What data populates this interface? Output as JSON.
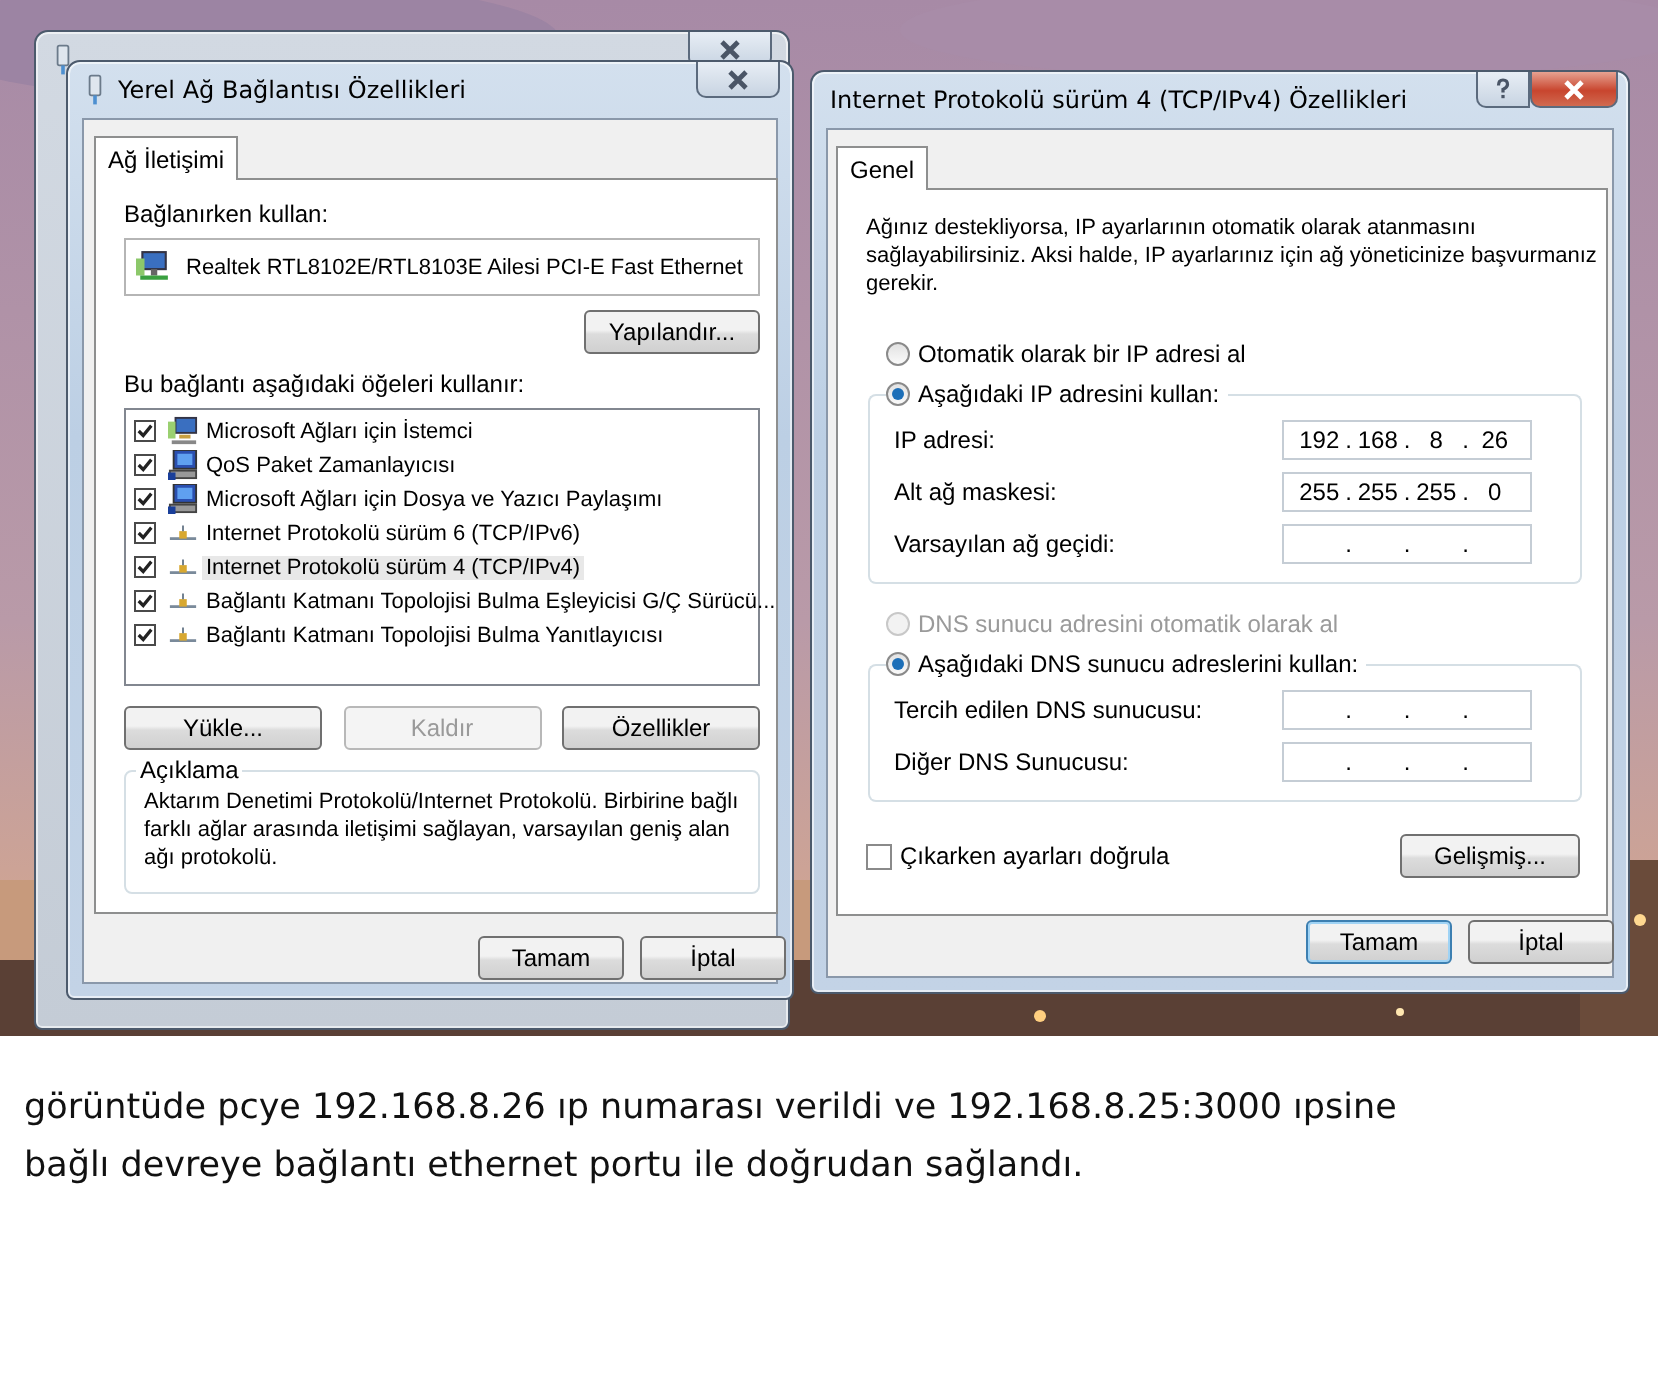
{
  "lan_properties": {
    "title": "Yerel Ağ Bağlantısı Özellikleri",
    "tabs": [
      {
        "label": "Ağ İletişimi",
        "selected": true
      }
    ],
    "connect_using_label": "Bağlanırken kullan:",
    "adapter": "Realtek RTL8102E/RTL8103E Ailesi PCI-E Fast Ethernet",
    "configure_button": "Yapılandır...",
    "items_label": "Bu bağlantı aşağıdaki öğeleri kullanır:",
    "items": [
      {
        "label": "Microsoft Ağları için İstemci",
        "kind": "client",
        "checked": true,
        "selected": false
      },
      {
        "label": "QoS Paket Zamanlayıcısı",
        "kind": "service",
        "checked": true,
        "selected": false
      },
      {
        "label": "Microsoft Ağları için Dosya ve Yazıcı Paylaşımı",
        "kind": "service",
        "checked": true,
        "selected": false
      },
      {
        "label": "Internet Protokolü sürüm 6 (TCP/IPv6)",
        "kind": "protocol",
        "checked": true,
        "selected": false
      },
      {
        "label": "Internet Protokolü sürüm 4 (TCP/IPv4)",
        "kind": "protocol",
        "checked": true,
        "selected": true
      },
      {
        "label": "Bağlantı Katmanı Topolojisi Bulma Eşleyicisi G/Ç Sürücü...",
        "kind": "protocol",
        "checked": true,
        "selected": false
      },
      {
        "label": "Bağlantı Katmanı Topolojisi Bulma Yanıtlayıcısı",
        "kind": "protocol",
        "checked": true,
        "selected": false
      }
    ],
    "item_buttons": [
      {
        "label": "Yükle...",
        "disabled": false
      },
      {
        "label": "Kaldır",
        "disabled": true
      },
      {
        "label": "Özellikler",
        "disabled": false
      }
    ],
    "description": {
      "title": "Açıklama",
      "text": "Aktarım Denetimi Protokolü/Internet Protokolü. Birbirine bağlı farklı ağlar arasında iletişimi sağlayan, varsayılan geniş alan ağı protokolü."
    },
    "footer_buttons": [
      {
        "label": "Tamam",
        "default": false
      },
      {
        "label": "İptal",
        "default": false
      }
    ]
  },
  "ipv4_properties": {
    "title": "Internet Protokolü sürüm 4 (TCP/IPv4) Özellikleri",
    "tabs": [
      {
        "label": "Genel",
        "selected": true
      }
    ],
    "intro": "Ağınız destekliyorsa, IP ayarlarının otomatik olarak atanmasını sağlayabilirsiniz. Aksi halde, IP ayarlarınız için ağ yöneticinize başvurmanız gerekir.",
    "separator": ".",
    "ip_modes": [
      {
        "label": "Otomatik olarak bir IP adresi al",
        "selected": false,
        "disabled": false
      },
      {
        "label": "Aşağıdaki IP adresini kullan:",
        "selected": true,
        "disabled": false
      }
    ],
    "ip_fields": [
      {
        "label": "IP adresi:",
        "octets": [
          "192",
          "168",
          "8",
          "26"
        ]
      },
      {
        "label": "Alt ağ maskesi:",
        "octets": [
          "255",
          "255",
          "255",
          "0"
        ]
      },
      {
        "label": "Varsayılan ağ geçidi:"
      }
    ],
    "dns_modes": [
      {
        "label": "DNS sunucu adresini otomatik olarak al",
        "selected": false,
        "disabled": true
      },
      {
        "label": "Aşağıdaki DNS sunucu adreslerini kullan:",
        "selected": true,
        "disabled": false
      }
    ],
    "dns_fields": [
      {
        "label": "Tercih edilen DNS sunucusu:"
      },
      {
        "label": "Diğer DNS Sunucusu:"
      }
    ],
    "validate": {
      "label": "Çıkarken ayarları doğrula",
      "checked": false
    },
    "advanced_button": "Gelişmiş...",
    "footer_buttons": [
      {
        "label": "Tamam",
        "default": true
      },
      {
        "label": "İptal",
        "default": false
      }
    ]
  },
  "caption_lines": [
    "görüntüde pcye 192.168.8.26 ıp numarası verildi ve 192.168.8.25:3000 ıpsine",
    "bağlı devreye bağlantı ethernet portu ile doğrudan sağlandı."
  ]
}
